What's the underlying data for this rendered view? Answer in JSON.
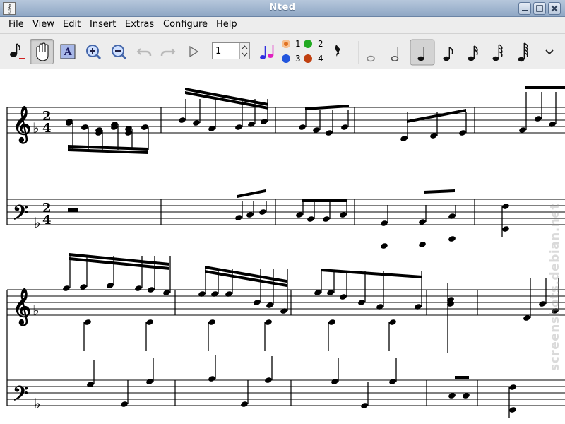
{
  "window": {
    "title": "Nted"
  },
  "menu": {
    "items": [
      {
        "id": "file",
        "label": "File"
      },
      {
        "id": "view",
        "label": "View"
      },
      {
        "id": "edit",
        "label": "Edit"
      },
      {
        "id": "insert",
        "label": "Insert"
      },
      {
        "id": "extras",
        "label": "Extras"
      },
      {
        "id": "configure",
        "label": "Configure"
      },
      {
        "id": "help",
        "label": "Help"
      }
    ]
  },
  "toolbar": {
    "staff_value": "1",
    "voices": [
      {
        "label": "1",
        "color": "#e07020"
      },
      {
        "label": "2",
        "color": "#22aa22"
      },
      {
        "label": "3",
        "color": "#2255dd"
      },
      {
        "label": "4",
        "color": "#c04010"
      }
    ]
  },
  "watermark": "screenshots.debian.net",
  "colors": {
    "titlebar": "#9fb4cf",
    "accent_note": "#e02090"
  }
}
